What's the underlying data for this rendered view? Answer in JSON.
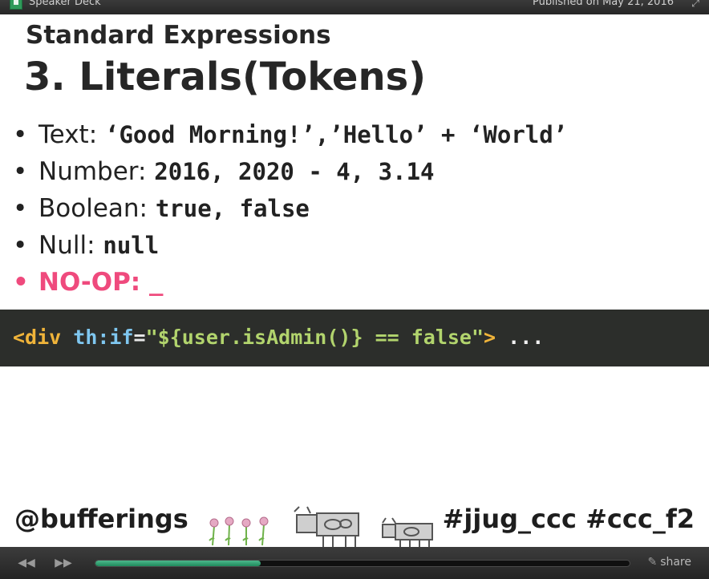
{
  "topbar": {
    "brand": "Speaker Deck",
    "published": "Published on May 21, 2016",
    "fullscreen_icon": "fullscreen-icon"
  },
  "slide": {
    "subtitle": "Standard Expressions",
    "title": "3. Literals(Tokens)",
    "bullets": [
      {
        "label": "Text: ",
        "code": "‘Good Morning!’,’Hello’ + ‘World’"
      },
      {
        "label": "Number: ",
        "code": "2016, 2020 - 4, 3.14"
      },
      {
        "label": "Boolean: ",
        "code": "true, false"
      },
      {
        "label": "Null: ",
        "code": "null"
      },
      {
        "label": "NO-OP: ",
        "code": "_"
      }
    ],
    "code": {
      "tag": "<div",
      "attr": " th:if",
      "eq": "=",
      "value": "\"${user.isAdmin()} == false\"",
      "close": ">",
      "rest": " ..."
    },
    "footer": {
      "handle": "@bufferings",
      "hashtags": "#jjug_ccc #ccc_f2"
    },
    "colors": {
      "highlight": "#ef4a7d",
      "code_bg": "#2c2e2b",
      "tag": "#f0b43a",
      "attr": "#7fc7f0",
      "string": "#b2d46d"
    }
  },
  "controls": {
    "prev_icon": "rewind-icon",
    "next_icon": "fast-forward-icon",
    "progress": 0.31,
    "share_label": "share"
  }
}
